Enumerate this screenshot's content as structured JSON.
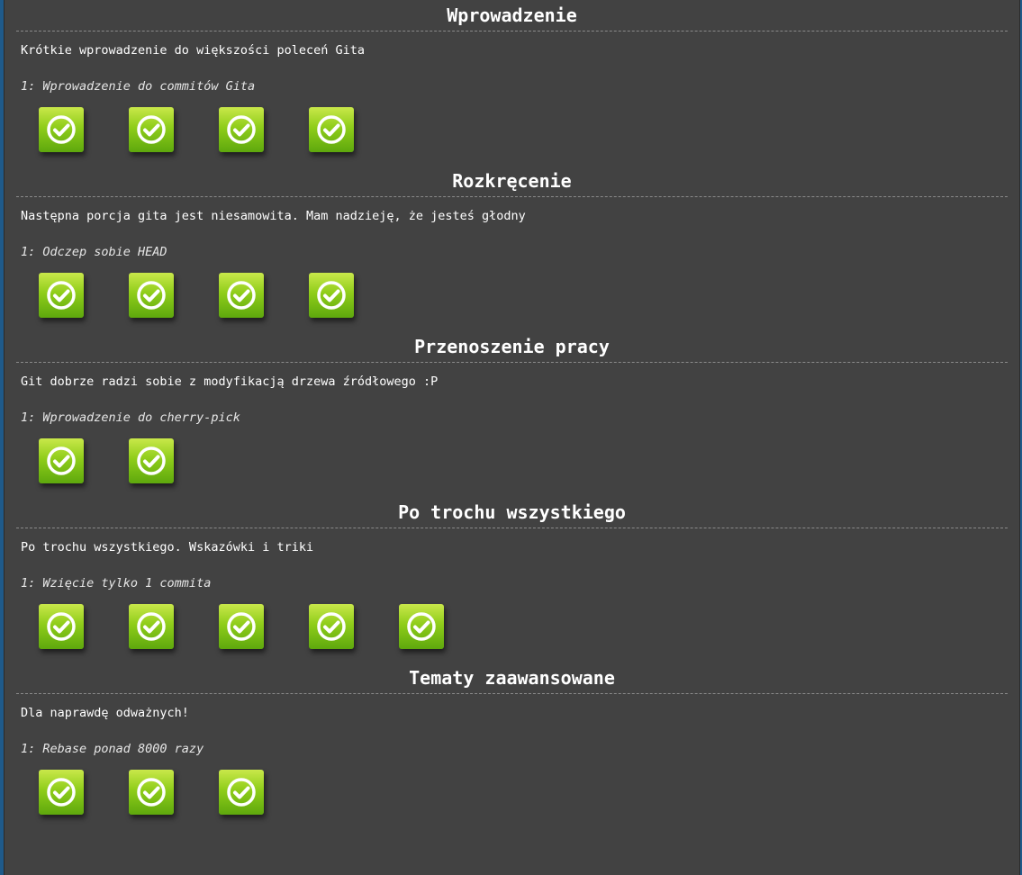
{
  "sequences": [
    {
      "title": "Wprowadzenie",
      "about": "Krótkie wprowadzenie do większości poleceń Gita",
      "level": "1: Wprowadzenie do commitów Gita",
      "levels": [
        {
          "state": "completed",
          "icon": "check-icon"
        },
        {
          "state": "completed",
          "icon": "check-icon"
        },
        {
          "state": "completed",
          "icon": "check-icon"
        },
        {
          "state": "completed",
          "icon": "check-icon"
        }
      ]
    },
    {
      "title": "Rozkręcenie",
      "about": "Następna porcja gita jest niesamowita. Mam nadzieję, że jesteś głodny",
      "level": "1: Odczep sobie HEAD",
      "levels": [
        {
          "state": "completed",
          "icon": "check-icon"
        },
        {
          "state": "completed",
          "icon": "check-icon"
        },
        {
          "state": "completed",
          "icon": "check-icon"
        },
        {
          "state": "completed",
          "icon": "check-icon"
        }
      ]
    },
    {
      "title": "Przenoszenie pracy",
      "about": "Git dobrze radzi sobie z modyfikacją drzewa źródłowego :P",
      "level": "1: Wprowadzenie do cherry-pick",
      "levels": [
        {
          "state": "completed",
          "icon": "check-icon"
        },
        {
          "state": "completed",
          "icon": "check-icon"
        }
      ]
    },
    {
      "title": "Po trochu wszystkiego",
      "about": "Po trochu wszystkiego. Wskazówki i triki",
      "level": "1: Wzięcie tylko 1 commita",
      "levels": [
        {
          "state": "completed",
          "icon": "check-icon"
        },
        {
          "state": "completed",
          "icon": "check-icon"
        },
        {
          "state": "completed",
          "icon": "check-icon"
        },
        {
          "state": "completed",
          "icon": "check-icon"
        },
        {
          "state": "completed",
          "icon": "check-icon"
        }
      ]
    },
    {
      "title": "Tematy zaawansowane",
      "about": "Dla naprawdę odważnych!",
      "level": "1: Rebase ponad 8000 razy",
      "levels": [
        {
          "state": "completed",
          "icon": "check-icon"
        },
        {
          "state": "completed",
          "icon": "check-icon"
        },
        {
          "state": "completed",
          "icon": "check-icon"
        }
      ]
    }
  ],
  "colors": {
    "panel_background": "#424242",
    "level_button_green": "#8fcd1a",
    "text": "#ffffff"
  }
}
